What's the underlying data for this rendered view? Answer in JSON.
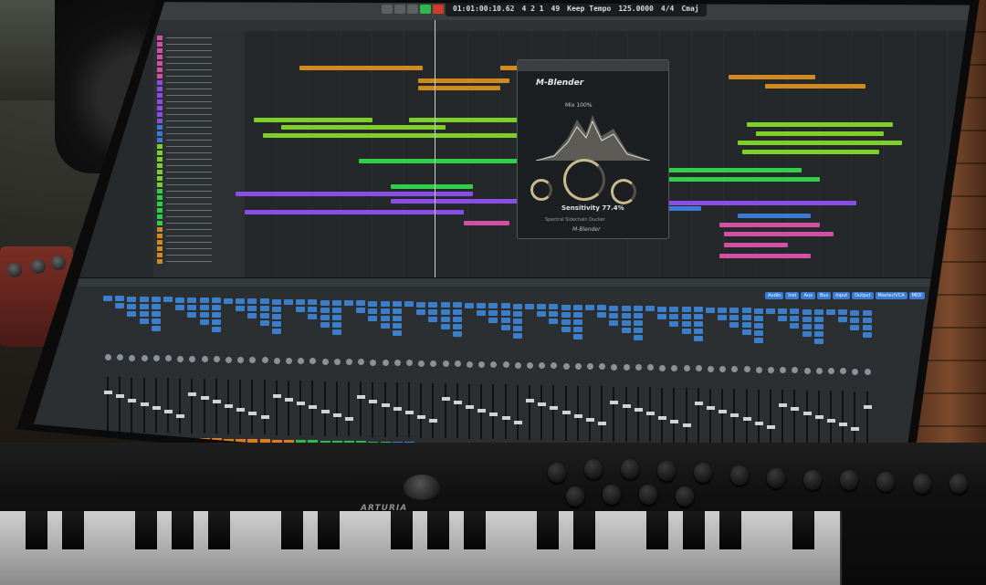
{
  "transport": {
    "position": "01:01:00:10.62",
    "bar": "4 2 1",
    "beats": "49",
    "mode": "Keep Tempo",
    "tempo": "125.0000",
    "signature": "4/4",
    "key": "Cmaj"
  },
  "plugin": {
    "name": "M-Blender",
    "mix_label": "Mix",
    "mix_value": "100%",
    "sensitivity_label": "Sensitivity",
    "sensitivity_value": "77.4%",
    "type_label": "Spectral Sidechain Ducker",
    "footer": "M-Blender",
    "colors": {
      "panel": "#1b1f22",
      "dial": "#c9b98c"
    }
  },
  "mixer": {
    "tabs": [
      "Audio",
      "Inst",
      "Aux",
      "Bus",
      "Input",
      "Output",
      "Master/VCA",
      "MIDI"
    ]
  },
  "keyboard": {
    "brand": "ARTURIA"
  },
  "colors": {
    "region_orange": "#d08a1e",
    "region_green": "#7fcf2a",
    "region_lime": "#2fcf4a",
    "region_purple": "#8a4ee6",
    "region_pink": "#d44fa6",
    "region_blue": "#3a7bd5"
  }
}
